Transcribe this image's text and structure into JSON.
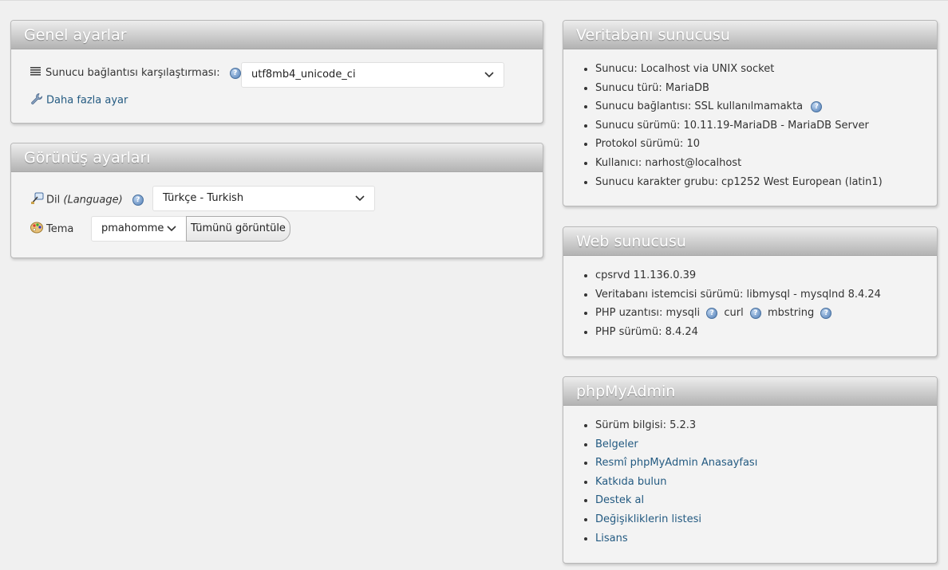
{
  "general": {
    "title": "Genel ayarlar",
    "collation_label": "Sunucu bağlantısı karşılaştırması:",
    "collation_value": "utf8mb4_unicode_ci",
    "more_settings": "Daha fazla ayar"
  },
  "appearance": {
    "title": "Görünüş ayarları",
    "language_label": "Dil",
    "language_hint": "(Language)",
    "language_value": "Türkçe - Turkish",
    "theme_label": "Tema",
    "theme_value": "pmahomme",
    "view_all": "Tümünü görüntüle"
  },
  "db_server": {
    "title": "Veritabanı sunucusu",
    "items": [
      "Sunucu: Localhost via UNIX socket",
      "Sunucu türü: MariaDB",
      "Sunucu bağlantısı: SSL kullanılmamakta",
      "Sunucu sürümü: 10.11.19-MariaDB - MariaDB Server",
      "Protokol sürümü: 10",
      "Kullanıcı: narhost@localhost",
      "Sunucu karakter grubu: cp1252 West European (latin1)"
    ]
  },
  "web_server": {
    "title": "Web sunucusu",
    "items": [
      "cpsrvd 11.136.0.39",
      "Veritabanı istemcisi sürümü: libmysql - mysqlnd 8.4.24"
    ],
    "php_ext_label": "PHP uzantısı:",
    "php_ext": [
      "mysqli",
      "curl",
      "mbstring"
    ],
    "php_version": "PHP sürümü: 8.4.24"
  },
  "pma": {
    "title": "phpMyAdmin",
    "version": "Sürüm bilgisi: 5.2.3",
    "links": [
      "Belgeler",
      "Resmî phpMyAdmin Anasayfası",
      "Katkıda bulun",
      "Destek al",
      "Değişikliklerin listesi",
      "Lisans"
    ]
  }
}
